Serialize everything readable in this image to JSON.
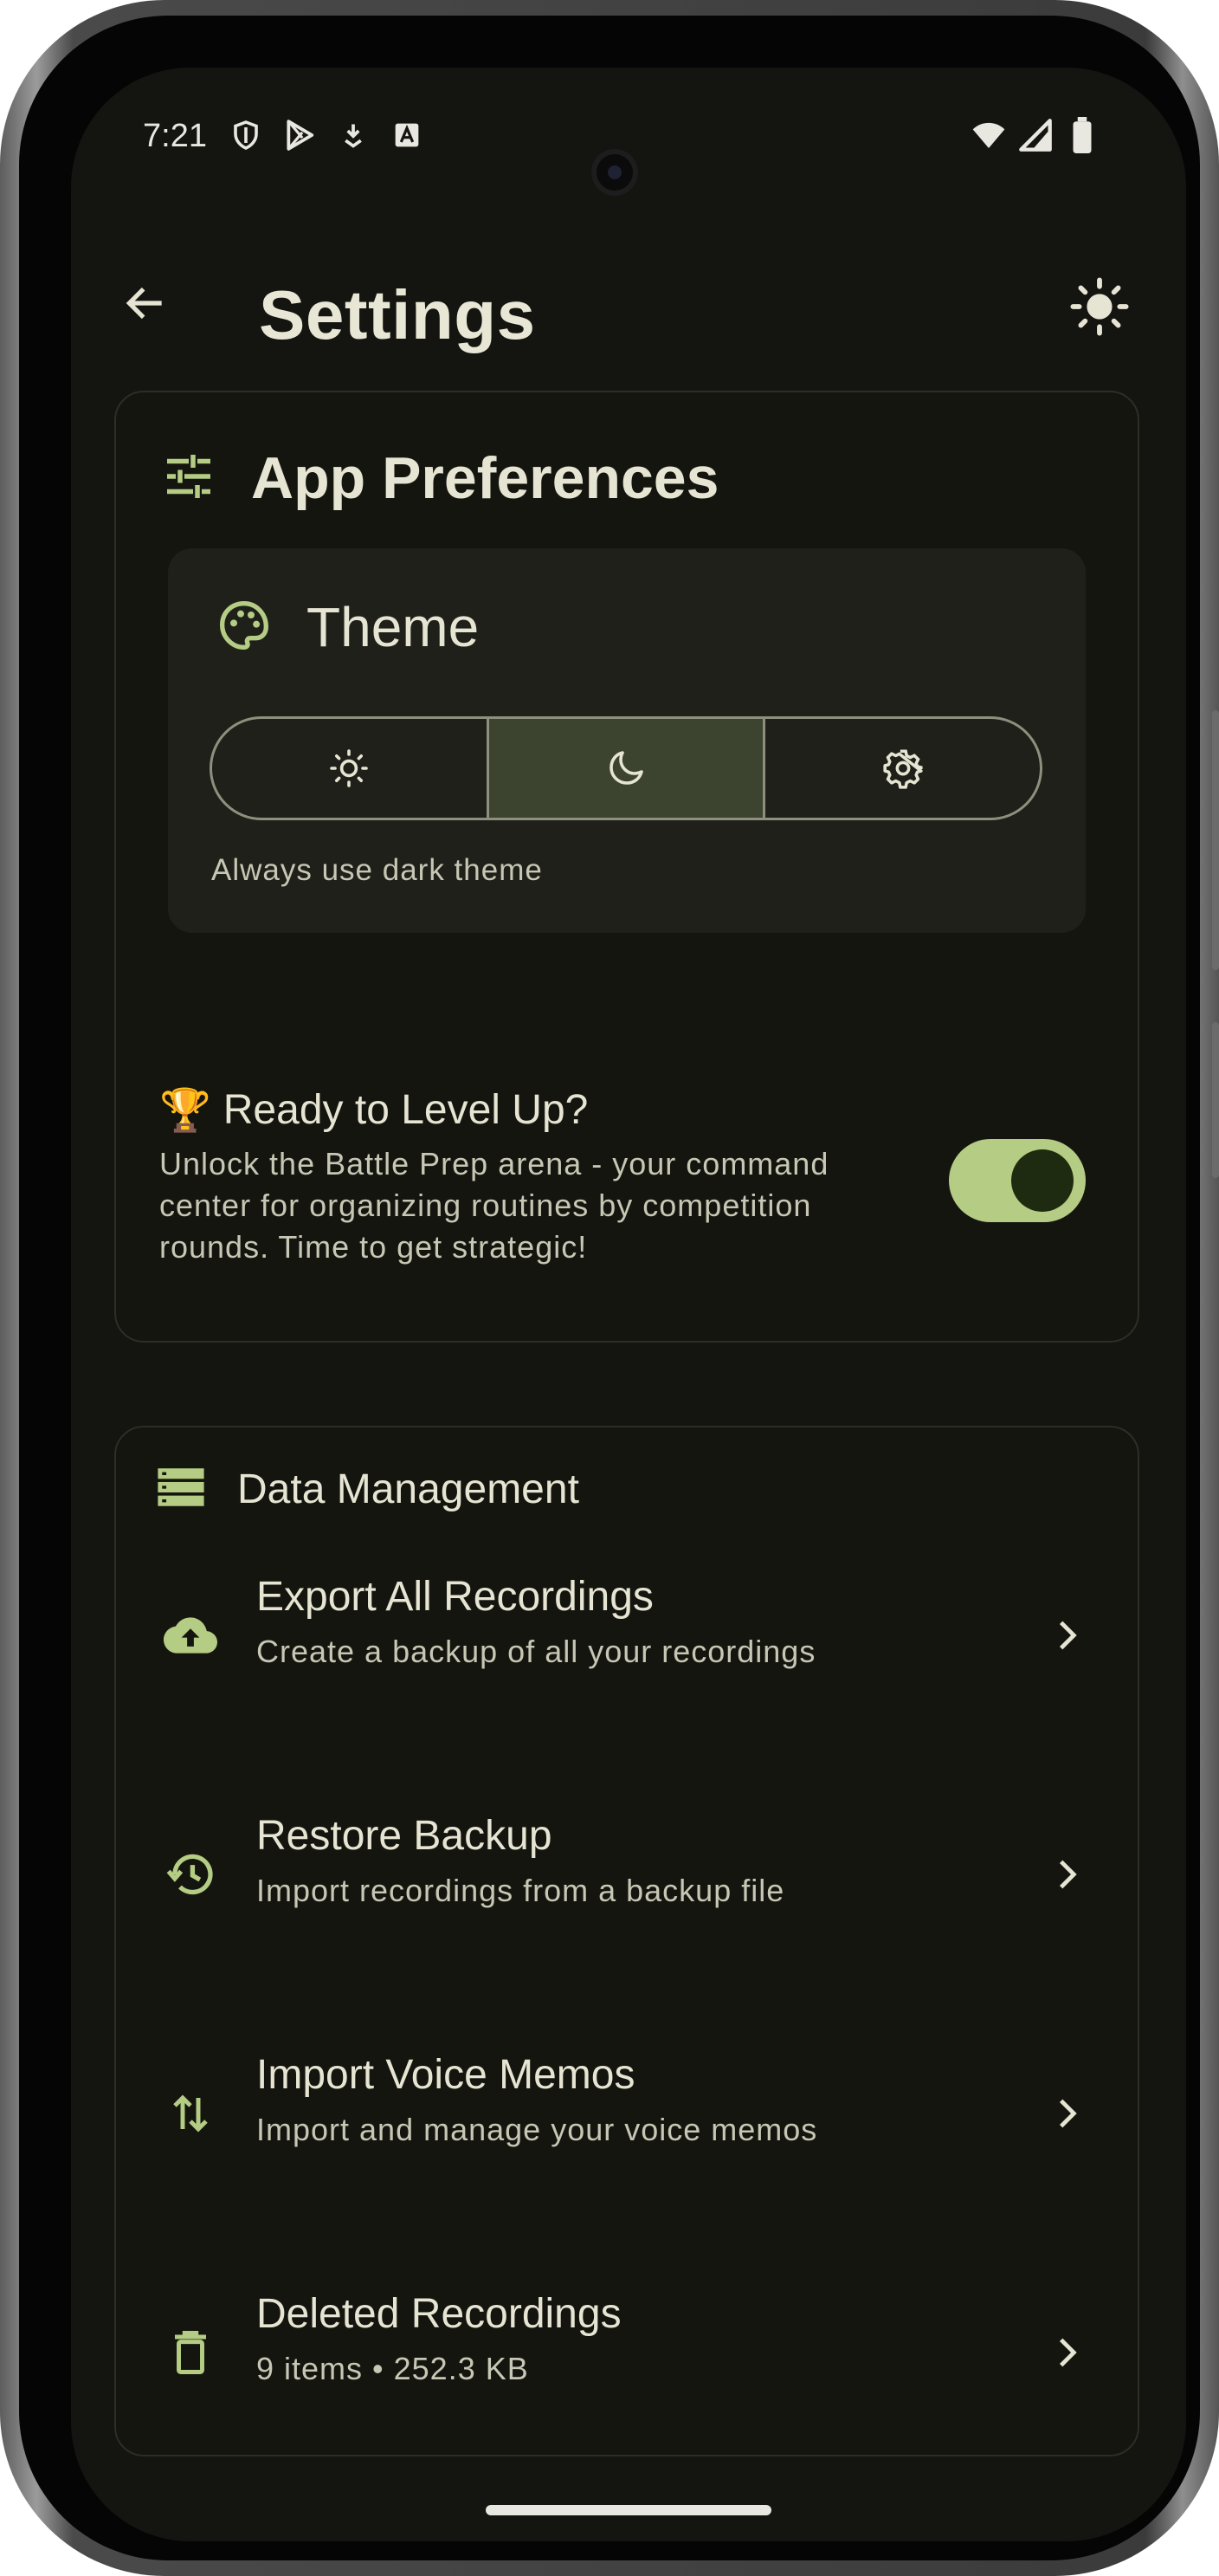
{
  "status_bar": {
    "time": "7:21"
  },
  "header": {
    "title": "Settings"
  },
  "app_preferences": {
    "title": "App Preferences",
    "theme": {
      "title": "Theme",
      "options": [
        "light",
        "dark",
        "system"
      ],
      "selected": "dark",
      "description": "Always use dark theme"
    },
    "battle_prep": {
      "emoji": "🏆",
      "title": "Ready to Level Up?",
      "description": "Unlock the Battle Prep arena - your command center for organizing routines by competition rounds. Time to get strategic!",
      "enabled": true
    }
  },
  "data_management": {
    "title": "Data Management",
    "items": [
      {
        "title": "Export All Recordings",
        "subtitle": "Create a backup of all your recordings",
        "icon": "cloud-upload-icon"
      },
      {
        "title": "Restore Backup",
        "subtitle": "Import recordings from a backup file",
        "icon": "restore-history-icon"
      },
      {
        "title": "Import Voice Memos",
        "subtitle": "Import and manage your voice memos",
        "icon": "import-arrows-icon"
      },
      {
        "title": "Deleted Recordings",
        "subtitle": "9 items • 252.3 KB",
        "icon": "trash-icon"
      }
    ]
  },
  "colors": {
    "background": "#141410",
    "accent": "#b4cc84",
    "text": "#e6e4d2",
    "subtext": "#c6c7b4",
    "segment_active": "#3c4430"
  }
}
